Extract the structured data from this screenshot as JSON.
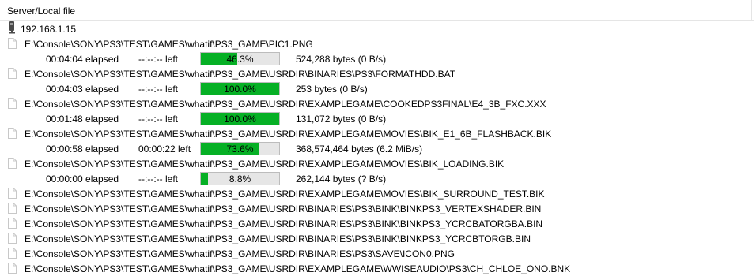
{
  "header": {
    "column_title": "Server/Local file"
  },
  "server": {
    "address": "192.168.1.15",
    "icon": "server-icon"
  },
  "transfers": [
    {
      "path": "E:\\Console\\SONY\\PS3\\TEST\\GAMES\\whatif\\PS3_GAME\\PIC1.PNG",
      "elapsed": "00:04:04 elapsed",
      "left": "--:--:-- left",
      "percent": 46.3,
      "percent_label": "46.3%",
      "bytes": "524,288 bytes (0 B/s)"
    },
    {
      "path": "E:\\Console\\SONY\\PS3\\TEST\\GAMES\\whatif\\PS3_GAME\\USRDIR\\BINARIES\\PS3\\FORMATHDD.BAT",
      "elapsed": "00:04:03 elapsed",
      "left": "--:--:-- left",
      "percent": 100,
      "percent_label": "100.0%",
      "bytes": "253 bytes (0 B/s)"
    },
    {
      "path": "E:\\Console\\SONY\\PS3\\TEST\\GAMES\\whatif\\PS3_GAME\\USRDIR\\EXAMPLEGAME\\COOKEDPS3FINAL\\E4_3B_FXC.XXX",
      "elapsed": "00:01:48 elapsed",
      "left": "--:--:-- left",
      "percent": 100,
      "percent_label": "100.0%",
      "bytes": "131,072 bytes (0 B/s)"
    },
    {
      "path": "E:\\Console\\SONY\\PS3\\TEST\\GAMES\\whatif\\PS3_GAME\\USRDIR\\EXAMPLEGAME\\MOVIES\\BIK_E1_6B_FLASHBACK.BIK",
      "elapsed": "00:00:58 elapsed",
      "left": "00:00:22 left",
      "percent": 73.6,
      "percent_label": "73.6%",
      "bytes": "368,574,464 bytes (6.2 MiB/s)"
    },
    {
      "path": "E:\\Console\\SONY\\PS3\\TEST\\GAMES\\whatif\\PS3_GAME\\USRDIR\\EXAMPLEGAME\\MOVIES\\BIK_LOADING.BIK",
      "elapsed": "00:00:00 elapsed",
      "left": "--:--:-- left",
      "percent": 8.8,
      "percent_label": "8.8%",
      "bytes": "262,144 bytes (? B/s)"
    }
  ],
  "queued": [
    "E:\\Console\\SONY\\PS3\\TEST\\GAMES\\whatif\\PS3_GAME\\USRDIR\\EXAMPLEGAME\\MOVIES\\BIK_SURROUND_TEST.BIK",
    "E:\\Console\\SONY\\PS3\\TEST\\GAMES\\whatif\\PS3_GAME\\USRDIR\\BINARIES\\PS3\\BINK\\BINKPS3_VERTEXSHADER.BIN",
    "E:\\Console\\SONY\\PS3\\TEST\\GAMES\\whatif\\PS3_GAME\\USRDIR\\BINARIES\\PS3\\BINK\\BINKPS3_YCRCBATORGBA.BIN",
    "E:\\Console\\SONY\\PS3\\TEST\\GAMES\\whatif\\PS3_GAME\\USRDIR\\BINARIES\\PS3\\BINK\\BINKPS3_YCRCBTORGB.BIN",
    "E:\\Console\\SONY\\PS3\\TEST\\GAMES\\whatif\\PS3_GAME\\USRDIR\\BINARIES\\PS3\\SAVE\\ICON0.PNG",
    "E:\\Console\\SONY\\PS3\\TEST\\GAMES\\whatif\\PS3_GAME\\USRDIR\\EXAMPLEGAME\\WWISEAUDIO\\PS3\\CH_CHLOE_ONO.BNK"
  ],
  "colors": {
    "progress_fill": "#06b025",
    "progress_track": "#e6e6e6"
  },
  "icons": {
    "file": "file-icon",
    "server": "server-icon"
  }
}
